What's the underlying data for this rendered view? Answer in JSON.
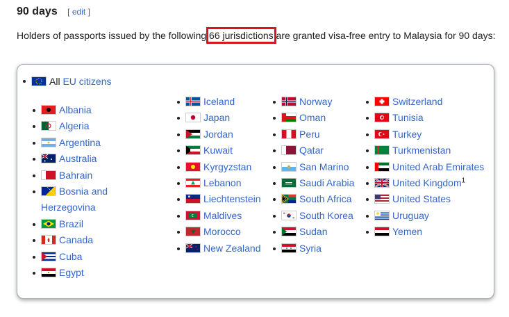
{
  "section": {
    "title": "90 days",
    "edit_open": "[",
    "edit_label": "edit",
    "edit_close": "]"
  },
  "intro": {
    "before": "Holders of passports issued by the following ",
    "highlight": "66 jurisdictions",
    "after": " are granted visa-free entry to Malaysia for 90 days:"
  },
  "eu": {
    "prefix": "All ",
    "link": "EU citizens"
  },
  "columns": [
    [
      {
        "name": "Albania",
        "flag": "albania"
      },
      {
        "name": "Algeria",
        "flag": "algeria"
      },
      {
        "name": "Argentina",
        "flag": "argentina"
      },
      {
        "name": "Australia",
        "flag": "australia"
      },
      {
        "name": "Bahrain",
        "flag": "bahrain"
      },
      {
        "name": "Bosnia and Herzegovina",
        "flag": "bosnia"
      },
      {
        "name": "Brazil",
        "flag": "brazil"
      },
      {
        "name": "Canada",
        "flag": "canada"
      },
      {
        "name": "Cuba",
        "flag": "cuba"
      },
      {
        "name": "Egypt",
        "flag": "egypt"
      }
    ],
    [
      {
        "name": "Iceland",
        "flag": "iceland"
      },
      {
        "name": "Japan",
        "flag": "japan"
      },
      {
        "name": "Jordan",
        "flag": "jordan"
      },
      {
        "name": "Kuwait",
        "flag": "kuwait"
      },
      {
        "name": "Kyrgyzstan",
        "flag": "kyrgyzstan"
      },
      {
        "name": "Lebanon",
        "flag": "lebanon"
      },
      {
        "name": "Liechtenstein",
        "flag": "liechtenstein"
      },
      {
        "name": "Maldives",
        "flag": "maldives"
      },
      {
        "name": "Morocco",
        "flag": "morocco"
      },
      {
        "name": "New Zealand",
        "flag": "newzealand"
      }
    ],
    [
      {
        "name": "Norway",
        "flag": "norway"
      },
      {
        "name": "Oman",
        "flag": "oman"
      },
      {
        "name": "Peru",
        "flag": "peru"
      },
      {
        "name": "Qatar",
        "flag": "qatar"
      },
      {
        "name": "San Marino",
        "flag": "sanmarino"
      },
      {
        "name": "Saudi Arabia",
        "flag": "saudi"
      },
      {
        "name": "South Africa",
        "flag": "southafrica"
      },
      {
        "name": "South Korea",
        "flag": "southkorea"
      },
      {
        "name": "Sudan",
        "flag": "sudan"
      },
      {
        "name": "Syria",
        "flag": "syria"
      }
    ],
    [
      {
        "name": "Switzerland",
        "flag": "switzerland"
      },
      {
        "name": "Tunisia",
        "flag": "tunisia"
      },
      {
        "name": "Turkey",
        "flag": "turkey"
      },
      {
        "name": "Turkmenistan",
        "flag": "turkmenistan"
      },
      {
        "name": "United Arab Emirates",
        "flag": "uae"
      },
      {
        "name": "United Kingdom",
        "flag": "uk",
        "sup": "1"
      },
      {
        "name": "United States",
        "flag": "us"
      },
      {
        "name": "Uruguay",
        "flag": "uruguay"
      },
      {
        "name": "Yemen",
        "flag": "yemen"
      }
    ]
  ],
  "colors": {
    "link": "#3366cc",
    "highlight": "#d9161e"
  }
}
